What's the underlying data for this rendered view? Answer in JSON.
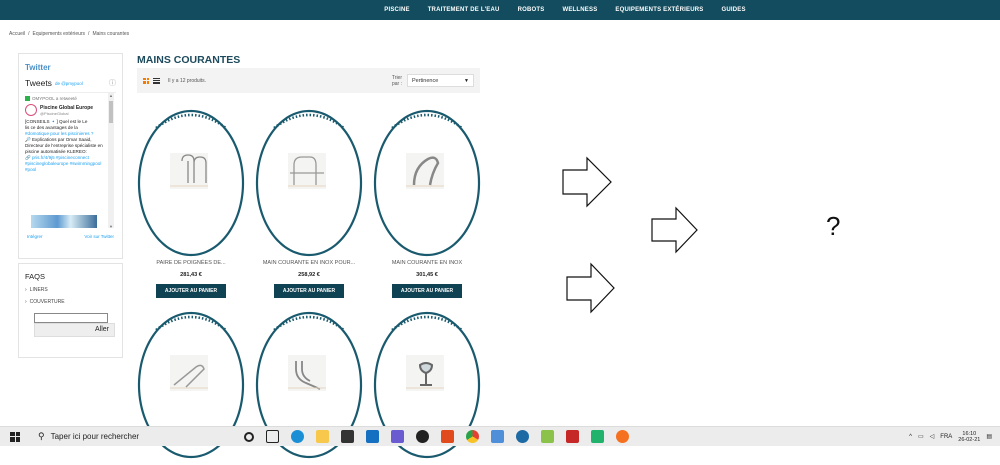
{
  "topnav": {
    "items": [
      "PISCINE",
      "TRAITEMENT DE L'EAU",
      "ROBOTS",
      "WELLNESS",
      "EQUIPEMENTS EXTÉRIEURS",
      "GUIDES"
    ]
  },
  "breadcrumb": {
    "items": [
      "Accueil",
      "/",
      "Equipements extérieurs",
      "/",
      "Mains courantes"
    ]
  },
  "sidebar": {
    "twitter_title": "Twitter",
    "tweets_label": "Tweets",
    "tweets_by": "de @pmypool",
    "retweet_text": "OMYPOOL a retweeté",
    "author_name": "Piscine Global Europe",
    "author_handle": "@PiscineGlobal",
    "tweet_body_1": "[CONSEILS 🔹] Quel est le Le",
    "tweet_body_2": "lis ce des avantages de la",
    "tweet_body_3": "#domotique pour les piscinieres ?",
    "tweet_body_4": "🔎 Explications par Omar Saaid, Directeur de l'entreprise spécialiste en piscine automatisée KLEREO:",
    "tweet_body_5": "🔗 pris.fr/4/9j5 #piscineconnect #piscineglobaleurope #swimmingpool #pool",
    "embed_label": "Intégrer",
    "view_on_twitter": "Voir sur Twitter",
    "faq_title": "FAQS",
    "faq_items": [
      "LINERS",
      "COUVERTURE"
    ],
    "faq_input_value": "",
    "faq_button": "Aller"
  },
  "main": {
    "title": "MAINS COURANTES",
    "product_count": "Il y a 12 produits.",
    "sort_label": "Trier par :",
    "sort_value": "Pertinence",
    "products": [
      {
        "name": "PAIRE DE POIGNÉES DE...",
        "price": "281,43 €",
        "button": "AJOUTER AU PANIER"
      },
      {
        "name": "MAIN COURANTE EN INOX POUR...",
        "price": "258,92 €",
        "button": "AJOUTER AU PANIER"
      },
      {
        "name": "MAIN COURANTE EN INOX",
        "price": "301,45 €",
        "button": "AJOUTER AU PANIER"
      },
      {
        "name": "",
        "price": "",
        "button": ""
      },
      {
        "name": "",
        "price": "",
        "button": ""
      },
      {
        "name": "",
        "price": "",
        "button": ""
      }
    ]
  },
  "annotation": {
    "question_mark": "?"
  },
  "taskbar": {
    "search_placeholder": "Taper ici pour rechercher",
    "tray_lang": "FRA",
    "time": "16:10",
    "date": "26-02-21"
  },
  "colors": {
    "nav_bg": "#134c5e",
    "accent_title": "#1d4b5d",
    "button_bg": "#0f4253",
    "grid_icon": "#f57c00",
    "ring": "#1a5a6e"
  }
}
